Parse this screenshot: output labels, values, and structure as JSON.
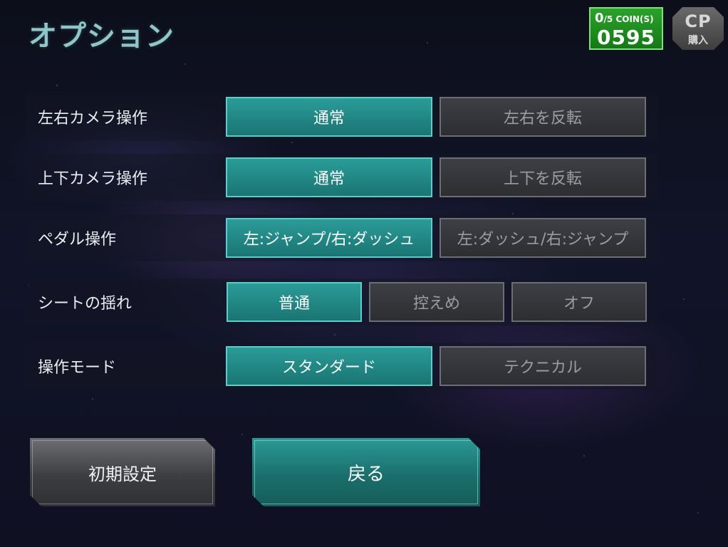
{
  "header": {
    "title": "オプション"
  },
  "coins": {
    "current": "0",
    "max_label": "/5 COIN(S)",
    "credit": "0595"
  },
  "cp_button": {
    "main": "CP",
    "sub": "購入"
  },
  "settings": [
    {
      "label": "左右カメラ操作",
      "options": [
        {
          "label": "通常",
          "selected": true
        },
        {
          "label": "左右を反転",
          "selected": false
        }
      ]
    },
    {
      "label": "上下カメラ操作",
      "options": [
        {
          "label": "通常",
          "selected": true
        },
        {
          "label": "上下を反転",
          "selected": false
        }
      ]
    },
    {
      "label": "ペダル操作",
      "options": [
        {
          "label": "左:ジャンプ/右:ダッシュ",
          "selected": true
        },
        {
          "label": "左:ダッシュ/右:ジャンプ",
          "selected": false
        }
      ]
    },
    {
      "label": "シートの揺れ",
      "options": [
        {
          "label": "普通",
          "selected": true
        },
        {
          "label": "控えめ",
          "selected": false
        },
        {
          "label": "オフ",
          "selected": false
        }
      ]
    },
    {
      "label": "操作モード",
      "options": [
        {
          "label": "スタンダード",
          "selected": true
        },
        {
          "label": "テクニカル",
          "selected": false
        }
      ]
    }
  ],
  "buttons": {
    "reset": "初期設定",
    "back": "戻る"
  },
  "colors": {
    "selected": "#2a9c98",
    "unselected": "#3d3f44",
    "title": "#8fc7c8",
    "coin_box": "#1f8f20"
  }
}
